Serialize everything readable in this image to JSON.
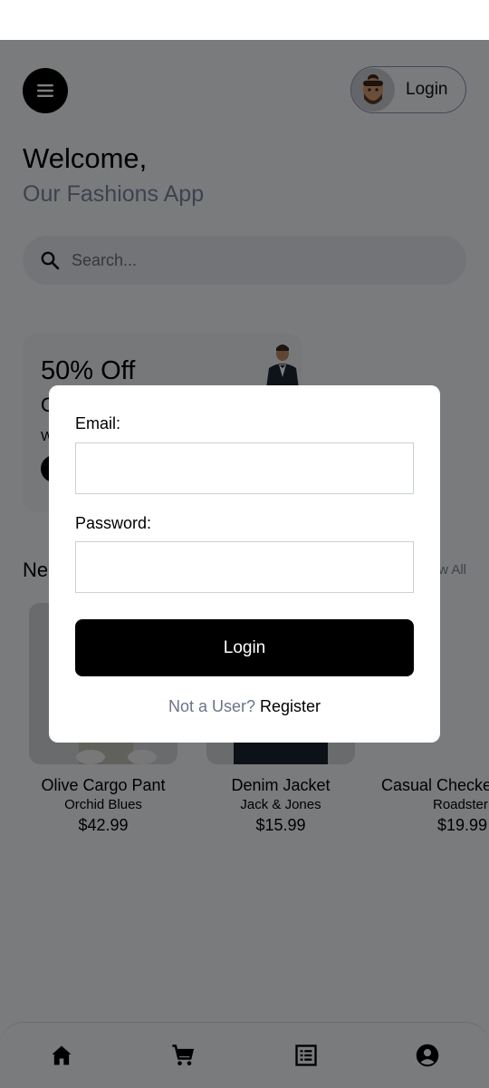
{
  "header": {
    "menu_icon": "hamburger-icon",
    "login_label": "Login",
    "avatar_icon": "memoji-avatar"
  },
  "welcome": {
    "title": "Welcome,",
    "subtitle": "Our Fashions App"
  },
  "search": {
    "placeholder": "Search...",
    "icon": "search-icon"
  },
  "promo": {
    "title": "50% Off",
    "line2": "O",
    "line3": "W"
  },
  "new_arrivals": {
    "title": "Ne",
    "view_all": "w All"
  },
  "products": [
    {
      "name": "Olive Cargo Pant",
      "brand": "Orchid Blues",
      "price": "$42.99"
    },
    {
      "name": "Denim Jacket",
      "brand": "Jack & Jones",
      "price": "$15.99"
    },
    {
      "name": "Casual Checke",
      "brand": "Roadster",
      "price": "$19.99"
    }
  ],
  "bottom_nav": {
    "items": [
      "home-icon",
      "cart-icon",
      "orders-icon",
      "profile-icon"
    ]
  },
  "login_modal": {
    "email_label": "Email:",
    "password_label": "Password:",
    "submit_label": "Login",
    "not_user_text": "Not a User?",
    "register_label": "Register"
  },
  "colors": {
    "accent": "#000000",
    "muted_text": "#7b859f",
    "scrim": "rgba(0,0,0,0.5)"
  }
}
